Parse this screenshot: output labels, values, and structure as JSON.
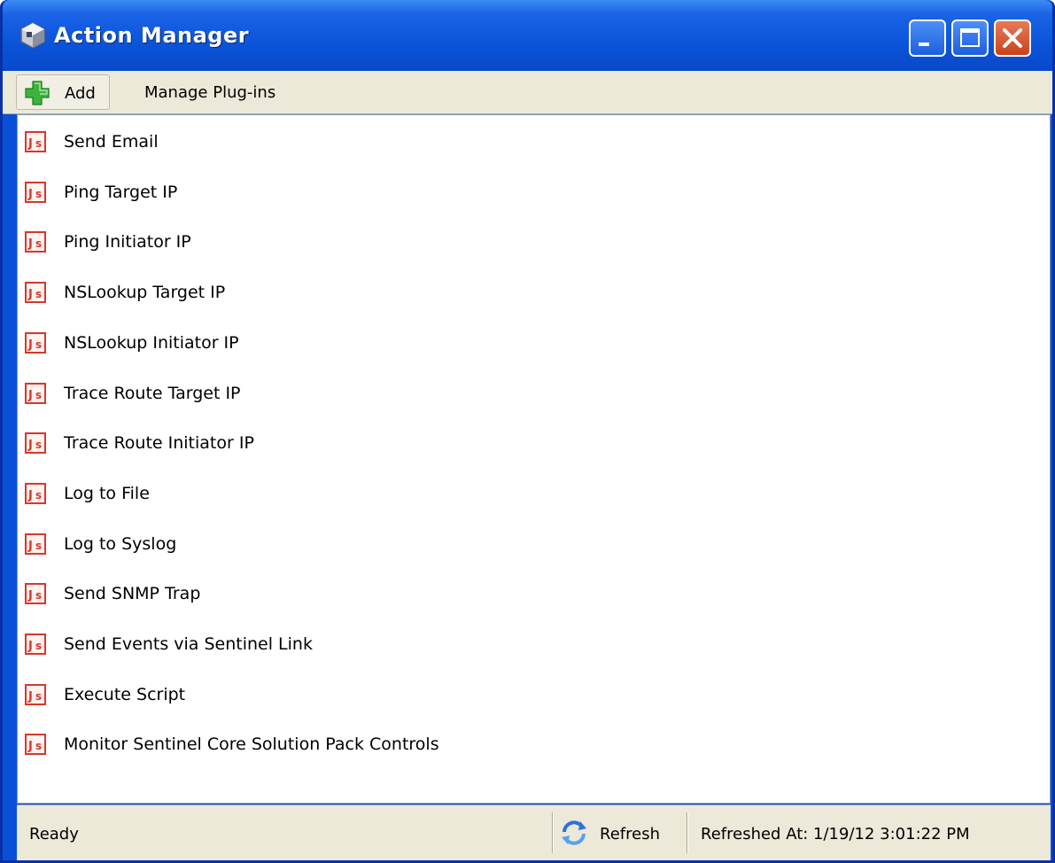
{
  "window": {
    "title": "Action Manager",
    "icon": "sentinel-cube-icon",
    "controls": [
      "minimize-icon",
      "maximize-icon",
      "close-icon"
    ]
  },
  "toolbar": {
    "add_label": "Add",
    "add_icon": "plus-icon",
    "manage_plugins_label": "Manage Plug-ins"
  },
  "actions": [
    {
      "label": "Send Email",
      "icon": "javascript-icon"
    },
    {
      "label": "Ping Target IP",
      "icon": "javascript-icon"
    },
    {
      "label": "Ping Initiator IP",
      "icon": "javascript-icon"
    },
    {
      "label": "NSLookup Target IP",
      "icon": "javascript-icon"
    },
    {
      "label": "NSLookup Initiator IP",
      "icon": "javascript-icon"
    },
    {
      "label": "Trace Route Target IP",
      "icon": "javascript-icon"
    },
    {
      "label": "Trace Route Initiator IP",
      "icon": "javascript-icon"
    },
    {
      "label": "Log to File",
      "icon": "javascript-icon"
    },
    {
      "label": "Log to Syslog",
      "icon": "javascript-icon"
    },
    {
      "label": "Send SNMP Trap",
      "icon": "javascript-icon"
    },
    {
      "label": "Send Events via Sentinel Link",
      "icon": "javascript-icon"
    },
    {
      "label": "Execute Script",
      "icon": "javascript-icon"
    },
    {
      "label": "Monitor Sentinel Core Solution Pack Controls",
      "icon": "javascript-icon"
    }
  ],
  "statusbar": {
    "status": "Ready",
    "refresh_label": "Refresh",
    "refresh_icon": "refresh-icon",
    "refreshed_at": "Refreshed At: 1/19/12 3:01:22 PM"
  },
  "colors": {
    "titlebar": "#0a52d8",
    "chrome": "#ece9d8",
    "close_button": "#c9431c",
    "add_icon": "#3cb43c",
    "item_icon": "#d7372b"
  }
}
